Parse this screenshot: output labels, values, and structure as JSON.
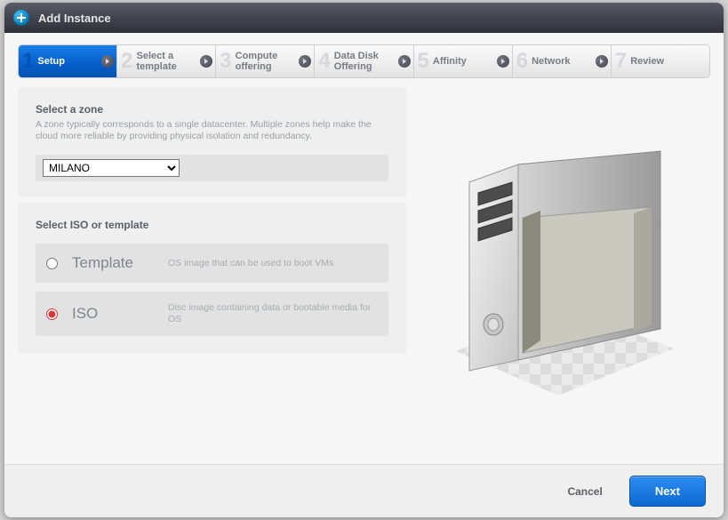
{
  "dialog": {
    "title": "Add Instance"
  },
  "steps": [
    {
      "num": "1",
      "label": "Setup"
    },
    {
      "num": "2",
      "label": "Select a template"
    },
    {
      "num": "3",
      "label": "Compute offering"
    },
    {
      "num": "4",
      "label": "Data Disk Offering"
    },
    {
      "num": "5",
      "label": "Affinity"
    },
    {
      "num": "6",
      "label": "Network"
    },
    {
      "num": "7",
      "label": "Review"
    }
  ],
  "zonePanel": {
    "title": "Select a zone",
    "desc": "A zone typically corresponds to a single datacenter. Multiple zones help make the cloud more reliable by providing physical isolation and redundancy.",
    "value": "MILANO"
  },
  "sourcePanel": {
    "title": "Select ISO or template",
    "options": [
      {
        "label": "Template",
        "desc": "OS image that can be used to boot VMs",
        "checked": false
      },
      {
        "label": "ISO",
        "desc": "Disc image containing data or bootable media for OS",
        "checked": true
      }
    ]
  },
  "buttons": {
    "cancel": "Cancel",
    "next": "Next"
  }
}
